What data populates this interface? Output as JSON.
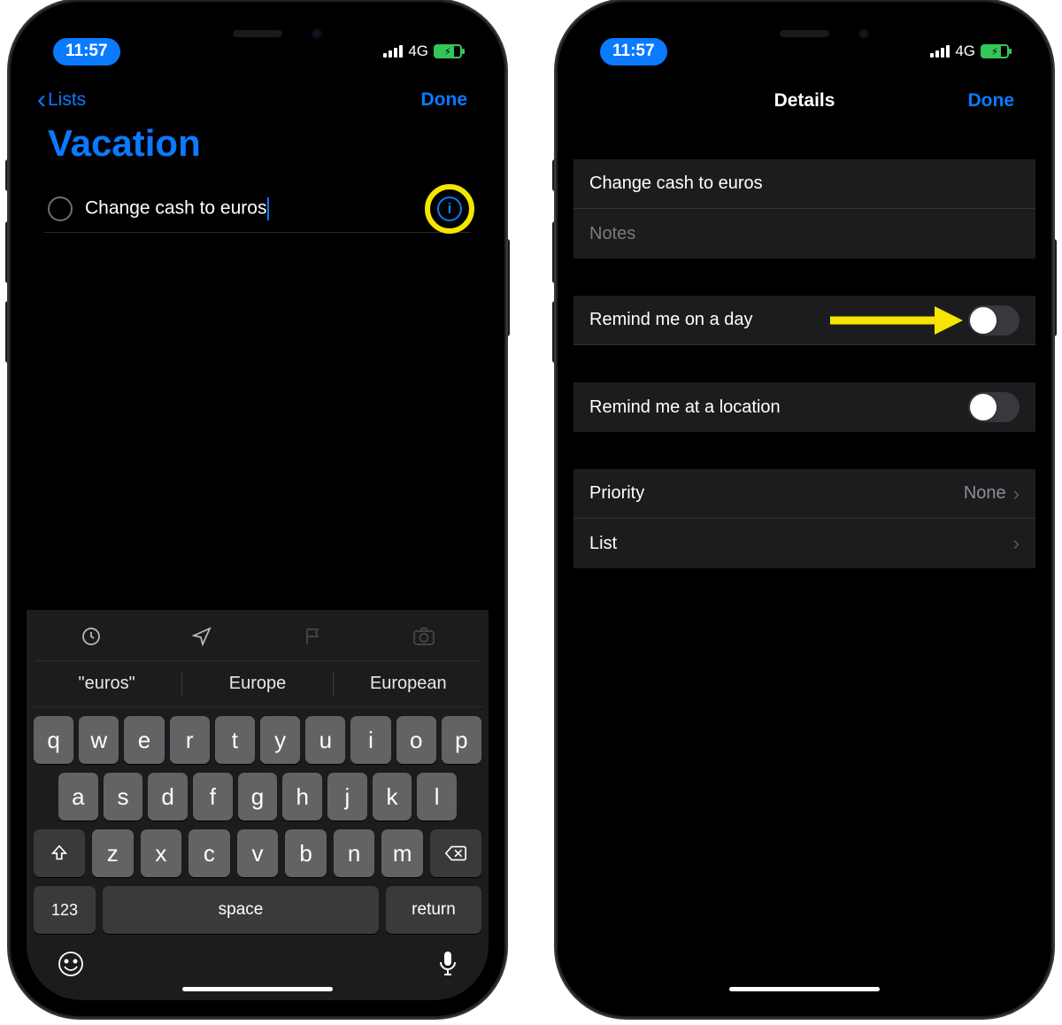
{
  "status": {
    "time": "11:57",
    "network": "4G"
  },
  "left": {
    "back_label": "Lists",
    "done_label": "Done",
    "list_title": "Vacation",
    "reminder_text": "Change cash to euros",
    "suggestions": [
      "\"euros\"",
      "Europe",
      "European"
    ],
    "keyboard": {
      "row1": [
        "q",
        "w",
        "e",
        "r",
        "t",
        "y",
        "u",
        "i",
        "o",
        "p"
      ],
      "row2": [
        "a",
        "s",
        "d",
        "f",
        "g",
        "h",
        "j",
        "k",
        "l"
      ],
      "row3": [
        "z",
        "x",
        "c",
        "v",
        "b",
        "n",
        "m"
      ],
      "numkey": "123",
      "space": "space",
      "return": "return"
    }
  },
  "right": {
    "title": "Details",
    "done_label": "Done",
    "title_field": "Change cash to euros",
    "notes_placeholder": "Notes",
    "remind_day_label": "Remind me on a day",
    "remind_loc_label": "Remind me at a location",
    "priority_label": "Priority",
    "priority_value": "None",
    "list_label": "List"
  }
}
